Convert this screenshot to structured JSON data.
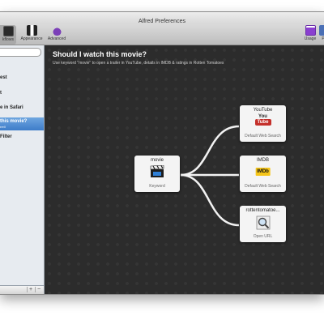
{
  "window": {
    "title": "Alfred Preferences"
  },
  "toolbar": {
    "workflows_label": "kflows",
    "appearance_label": "Appearance",
    "advanced_label": "Advanced",
    "usage_label": "Usage",
    "user_label": "P"
  },
  "sidebar": {
    "items": [
      {
        "title": "est",
        "subtitle": ""
      },
      {
        "title": "t",
        "subtitle": ""
      },
      {
        "title": "e in Safari",
        "subtitle": ""
      },
      {
        "title": "this movie?",
        "subtitle": "rrell",
        "selected": true
      },
      {
        "title": "Filter",
        "subtitle": ""
      }
    ],
    "add_label": "+",
    "remove_label": "−"
  },
  "workflow": {
    "title": "Should I watch this movie?",
    "description": "Use keyword \"movie\" to open a trailer in YouTube, details in IMDB & ratings in Rotten Tomatoes"
  },
  "nodes": {
    "keyword": {
      "title": "movie",
      "subtitle": "Keyword",
      "icon": "clapperboard-icon"
    },
    "youtube": {
      "title": "YouTube",
      "subtitle": "Default Web Search",
      "icon": "youtube-logo-icon",
      "logo_top": "You",
      "logo_bottom": "Tube"
    },
    "imdb": {
      "title": "IMDB",
      "subtitle": "Default Web Search",
      "icon": "imdb-logo-icon",
      "logo": "IMDb"
    },
    "rotten": {
      "title": "rottentomatoe...",
      "subtitle": "Open URL",
      "icon": "magnifier-icon"
    }
  },
  "colors": {
    "canvas": "#2c2c2c",
    "selection": "#3d7cc9",
    "youtube_red": "#c4302b",
    "imdb_yellow": "#f5c518"
  }
}
